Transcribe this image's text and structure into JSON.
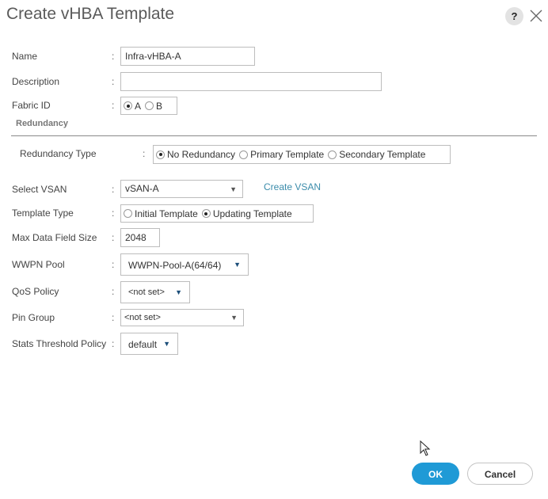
{
  "dialog": {
    "title": "Create vHBA Template",
    "help_label": "?",
    "close_icon": "close-icon"
  },
  "form": {
    "colon": ":",
    "name": {
      "label": "Name",
      "value": "Infra-vHBA-A"
    },
    "description": {
      "label": "Description",
      "value": ""
    },
    "fabric_id": {
      "label": "Fabric ID",
      "options": [
        {
          "label": "A",
          "selected": true
        },
        {
          "label": "B",
          "selected": false
        }
      ]
    },
    "redundancy_section": "Redundancy",
    "redundancy_type": {
      "label": "Redundancy Type",
      "options": [
        {
          "label": "No Redundancy",
          "selected": true
        },
        {
          "label": "Primary Template",
          "selected": false
        },
        {
          "label": "Secondary Template",
          "selected": false
        }
      ]
    },
    "select_vsan": {
      "label": "Select VSAN",
      "value": "vSAN-A",
      "link": "Create VSAN"
    },
    "template_type": {
      "label": "Template Type",
      "options": [
        {
          "label": "Initial Template",
          "selected": false
        },
        {
          "label": "Updating Template",
          "selected": true
        }
      ]
    },
    "max_data_field_size": {
      "label": "Max Data Field Size",
      "value": "2048"
    },
    "wwpn_pool": {
      "label": "WWPN Pool",
      "value": "WWPN-Pool-A(64/64)"
    },
    "qos_policy": {
      "label": "QoS Policy",
      "value": "<not set>"
    },
    "pin_group": {
      "label": "Pin Group",
      "value": "<not set>"
    },
    "stats_threshold_policy": {
      "label": "Stats Threshold Policy",
      "value": "default"
    }
  },
  "footer": {
    "ok_label": "OK",
    "cancel_label": "Cancel"
  },
  "colors": {
    "primary": "#1f9ad6",
    "link": "#3b8cab",
    "caret": "#1d4f7a"
  }
}
